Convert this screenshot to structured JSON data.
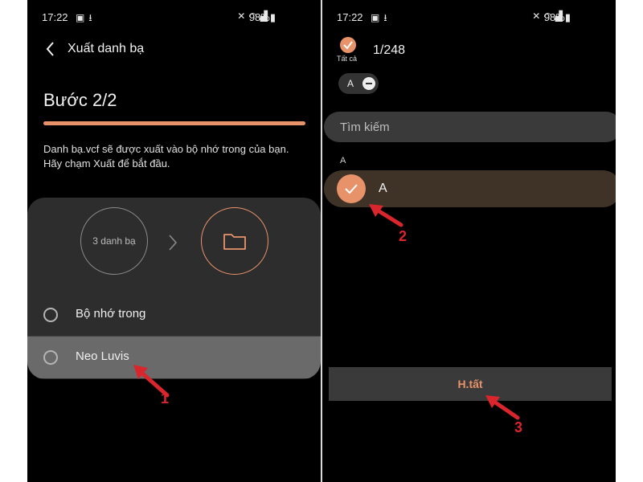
{
  "colors": {
    "accent": "#e8926a",
    "background": "#000000",
    "panel": "#2d2d2d",
    "highlight_row": "#6a6a6a",
    "selected_row": "#3f3226",
    "annotation": "#d9262c"
  },
  "left": {
    "status": {
      "time": "17:22",
      "battery": "98%"
    },
    "header": {
      "title": "Xuất danh bạ"
    },
    "step_label": "Bước 2/2",
    "progress_fraction": 1.0,
    "description": "Danh bạ.vcf sẽ được xuất vào bộ nhớ trong của bạn. Hãy chạm Xuất để bắt đầu.",
    "source_count_label": "3 danh bạ",
    "options": [
      {
        "label": "Bộ nhớ trong",
        "selected": false
      },
      {
        "label": "Neo Luvis",
        "selected": false,
        "highlighted": true
      }
    ],
    "annotation_number": "1"
  },
  "right": {
    "status": {
      "time": "17:22",
      "battery": "98%"
    },
    "select_all_label": "Tất cả",
    "selection_count": "1/248",
    "chip_letter": "A",
    "search_placeholder": "Tìm kiếm",
    "section_header": "A",
    "contact": {
      "name": "A",
      "checked": true
    },
    "done_label": "H.tất",
    "annotation_numbers": [
      "2",
      "3"
    ]
  },
  "icons": [
    "back-chevron-icon",
    "folder-icon",
    "chevron-right-icon",
    "check-icon",
    "minus-icon",
    "wifi-icon",
    "signal-icon",
    "battery-icon",
    "mute-icon",
    "gallery-icon",
    "download-icon"
  ]
}
